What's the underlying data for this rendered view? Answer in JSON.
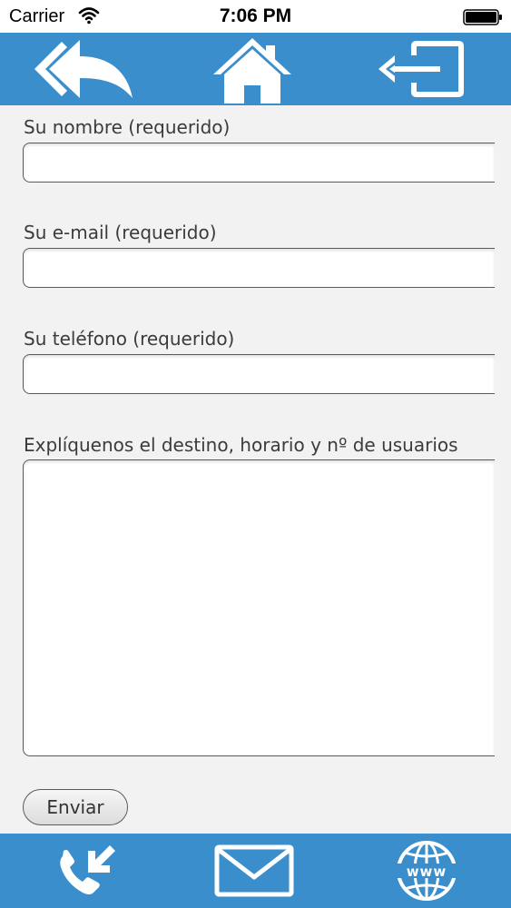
{
  "status_bar": {
    "carrier": "Carrier",
    "time": "7:06 PM"
  },
  "nav": {
    "icons": [
      "back-arrow-icon",
      "home-icon",
      "exit-icon"
    ]
  },
  "form": {
    "name_label": "Su nombre (requerido)",
    "name_value": "",
    "email_label": "Su e-mail (requerido)",
    "email_value": "",
    "phone_label": "Su teléfono (requerido)",
    "phone_value": "",
    "message_label": "Explíquenos el destino, horario y nº de usuarios",
    "message_value": "",
    "submit_label": "Enviar"
  },
  "bottom_bar": {
    "icons": [
      "incoming-call-icon",
      "mail-icon",
      "www-globe-icon"
    ]
  },
  "colors": {
    "bar_blue": "#3a8ecb",
    "background": "#f3f2f3",
    "icon_white": "#ffffff"
  }
}
